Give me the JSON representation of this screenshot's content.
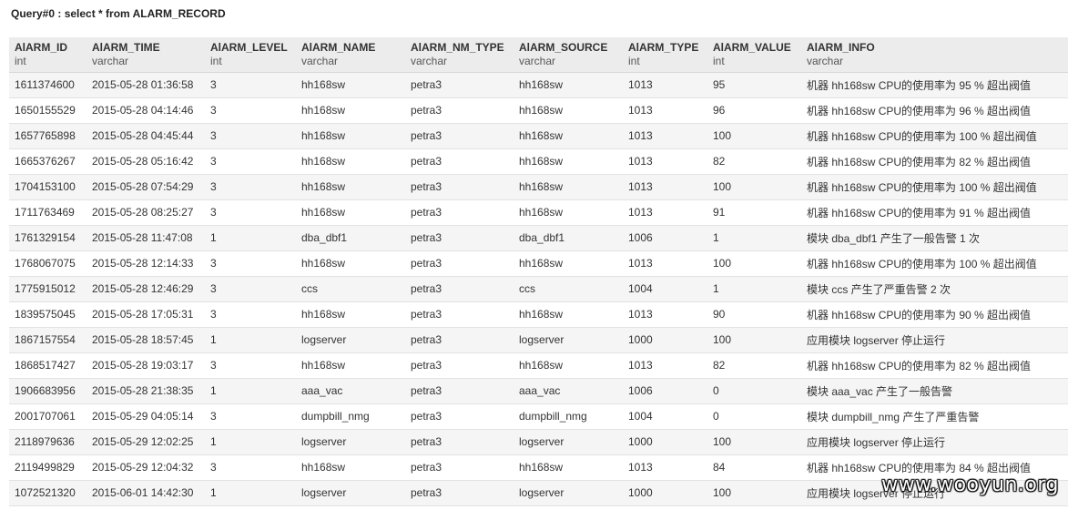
{
  "query": {
    "title": "Query#0 : select * from ALARM_RECORD"
  },
  "table": {
    "columns": [
      {
        "name": "AlARM_ID",
        "type": "int"
      },
      {
        "name": "AlARM_TIME",
        "type": "varchar"
      },
      {
        "name": "AlARM_LEVEL",
        "type": "int"
      },
      {
        "name": "AlARM_NAME",
        "type": "varchar"
      },
      {
        "name": "AlARM_NM_TYPE",
        "type": "varchar"
      },
      {
        "name": "AlARM_SOURCE",
        "type": "varchar"
      },
      {
        "name": "AlARM_TYPE",
        "type": "int"
      },
      {
        "name": "AlARM_VALUE",
        "type": "int"
      },
      {
        "name": "AlARM_INFO",
        "type": "varchar"
      }
    ],
    "rows": [
      [
        "1611374600",
        "2015-05-28 01:36:58",
        "3",
        "hh168sw",
        "petra3",
        "hh168sw",
        "1013",
        "95",
        "机器 hh168sw CPU的使用率为 95 % 超出阀值"
      ],
      [
        "1650155529",
        "2015-05-28 04:14:46",
        "3",
        "hh168sw",
        "petra3",
        "hh168sw",
        "1013",
        "96",
        "机器 hh168sw CPU的使用率为 96 % 超出阀值"
      ],
      [
        "1657765898",
        "2015-05-28 04:45:44",
        "3",
        "hh168sw",
        "petra3",
        "hh168sw",
        "1013",
        "100",
        "机器 hh168sw CPU的使用率为 100 % 超出阀值"
      ],
      [
        "1665376267",
        "2015-05-28 05:16:42",
        "3",
        "hh168sw",
        "petra3",
        "hh168sw",
        "1013",
        "82",
        "机器 hh168sw CPU的使用率为 82 % 超出阀值"
      ],
      [
        "1704153100",
        "2015-05-28 07:54:29",
        "3",
        "hh168sw",
        "petra3",
        "hh168sw",
        "1013",
        "100",
        "机器 hh168sw CPU的使用率为 100 % 超出阀值"
      ],
      [
        "1711763469",
        "2015-05-28 08:25:27",
        "3",
        "hh168sw",
        "petra3",
        "hh168sw",
        "1013",
        "91",
        "机器 hh168sw CPU的使用率为 91 % 超出阀值"
      ],
      [
        "1761329154",
        "2015-05-28 11:47:08",
        "1",
        "dba_dbf1",
        "petra3",
        "dba_dbf1",
        "1006",
        "1",
        "模块 dba_dbf1 产生了一般告警 1 次"
      ],
      [
        "1768067075",
        "2015-05-28 12:14:33",
        "3",
        "hh168sw",
        "petra3",
        "hh168sw",
        "1013",
        "100",
        "机器 hh168sw CPU的使用率为 100 % 超出阀值"
      ],
      [
        "1775915012",
        "2015-05-28 12:46:29",
        "3",
        "ccs",
        "petra3",
        "ccs",
        "1004",
        "1",
        "模块 ccs 产生了严重告警 2 次"
      ],
      [
        "1839575045",
        "2015-05-28 17:05:31",
        "3",
        "hh168sw",
        "petra3",
        "hh168sw",
        "1013",
        "90",
        "机器 hh168sw CPU的使用率为 90 % 超出阀值"
      ],
      [
        "1867157554",
        "2015-05-28 18:57:45",
        "1",
        "logserver",
        "petra3",
        "logserver",
        "1000",
        "100",
        "应用模块 logserver 停止运行"
      ],
      [
        "1868517427",
        "2015-05-28 19:03:17",
        "3",
        "hh168sw",
        "petra3",
        "hh168sw",
        "1013",
        "82",
        "机器 hh168sw CPU的使用率为 82 % 超出阀值"
      ],
      [
        "1906683956",
        "2015-05-28 21:38:35",
        "1",
        "aaa_vac",
        "petra3",
        "aaa_vac",
        "1006",
        "0",
        "模块 aaa_vac 产生了一般告警"
      ],
      [
        "2001707061",
        "2015-05-29 04:05:14",
        "3",
        "dumpbill_nmg",
        "petra3",
        "dumpbill_nmg",
        "1004",
        "0",
        "模块 dumpbill_nmg 产生了严重告警"
      ],
      [
        "2118979636",
        "2015-05-29 12:02:25",
        "1",
        "logserver",
        "petra3",
        "logserver",
        "1000",
        "100",
        "应用模块 logserver 停止运行"
      ],
      [
        "2119499829",
        "2015-05-29 12:04:32",
        "3",
        "hh168sw",
        "petra3",
        "hh168sw",
        "1013",
        "84",
        "机器 hh168sw CPU的使用率为 84 % 超出阀值"
      ],
      [
        "1072521320",
        "2015-06-01 14:42:30",
        "1",
        "logserver",
        "petra3",
        "logserver",
        "1000",
        "100",
        "应用模块 logserver 停止运行"
      ]
    ]
  },
  "watermark": {
    "text": "www.wooyun.org"
  }
}
